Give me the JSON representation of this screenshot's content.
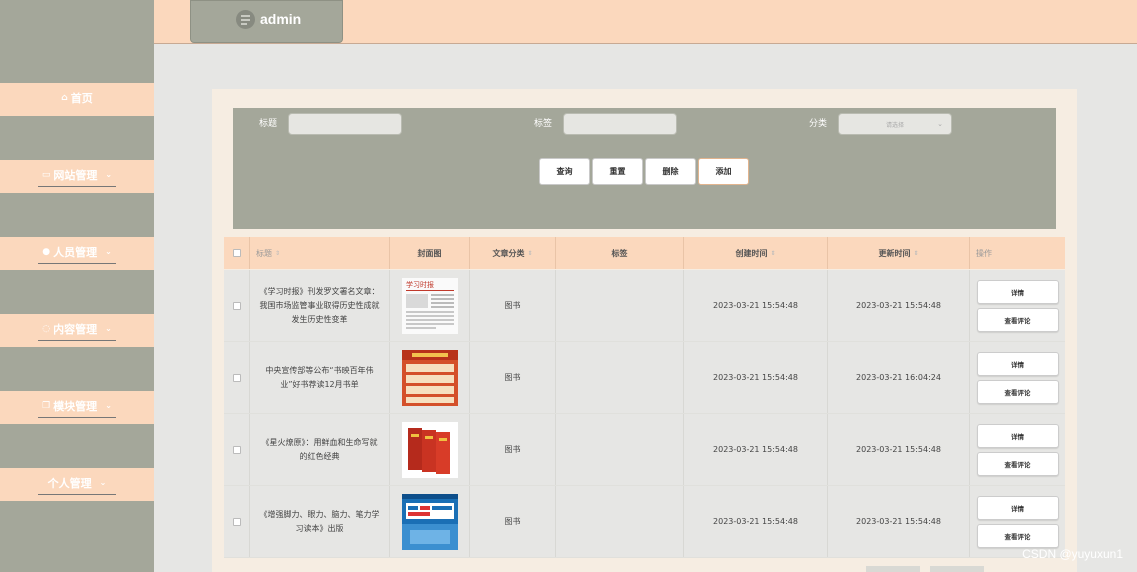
{
  "header": {
    "app_title": "admin",
    "logo_icon": "menu-lines-icon"
  },
  "sidebar": {
    "items": [
      {
        "label": "首页",
        "icon": "home-icon"
      },
      {
        "label": "网站管理",
        "icon": "monitor-icon"
      },
      {
        "label": "人员管理",
        "icon": "user-icon"
      },
      {
        "label": "内容管理",
        "icon": "chat-icon"
      },
      {
        "label": "模块管理",
        "icon": "copy-icon"
      },
      {
        "label": "个人管理",
        "icon": ""
      }
    ]
  },
  "filter": {
    "title_label": "标题",
    "tag_label": "标签",
    "category_label": "分类",
    "category_placeholder": "请选择",
    "buttons": {
      "search": "查询",
      "reset": "重置",
      "delete": "删除",
      "add": "添加"
    }
  },
  "table": {
    "headers": [
      "标题",
      "封面图",
      "文章分类",
      "标签",
      "创建时间",
      "更新时间",
      "操作"
    ],
    "rows": [
      {
        "title": "《学习时报》刊发罗文署名文章：我国市场监管事业取得历史性成就发生历史性变革",
        "category": "图书",
        "tag": "",
        "created": "2023-03-21 15:54:48",
        "updated": "2023-03-21 15:54:48"
      },
      {
        "title": "中央宣传部等公布“书映百年伟业”好书荐读12月书单",
        "category": "图书",
        "tag": "",
        "created": "2023-03-21 15:54:48",
        "updated": "2023-03-21 16:04:24"
      },
      {
        "title": "《星火燎原》：用鲜血和生命写就的红色经典",
        "category": "图书",
        "tag": "",
        "created": "2023-03-21 15:54:48",
        "updated": "2023-03-21 15:54:48"
      },
      {
        "title": "《增强脚力、眼力、脑力、笔力学习读本》出版",
        "category": "图书",
        "tag": "",
        "created": "2023-03-21 15:54:48",
        "updated": "2023-03-21 15:54:48"
      }
    ],
    "row_actions": {
      "detail": "详情",
      "comments": "查看评论"
    }
  },
  "watermark": "CSDN @yuyuxun1",
  "colors": {
    "sidebar": "#a4a79a",
    "accent": "#fbd8bd",
    "panel": "#f6ede2"
  }
}
